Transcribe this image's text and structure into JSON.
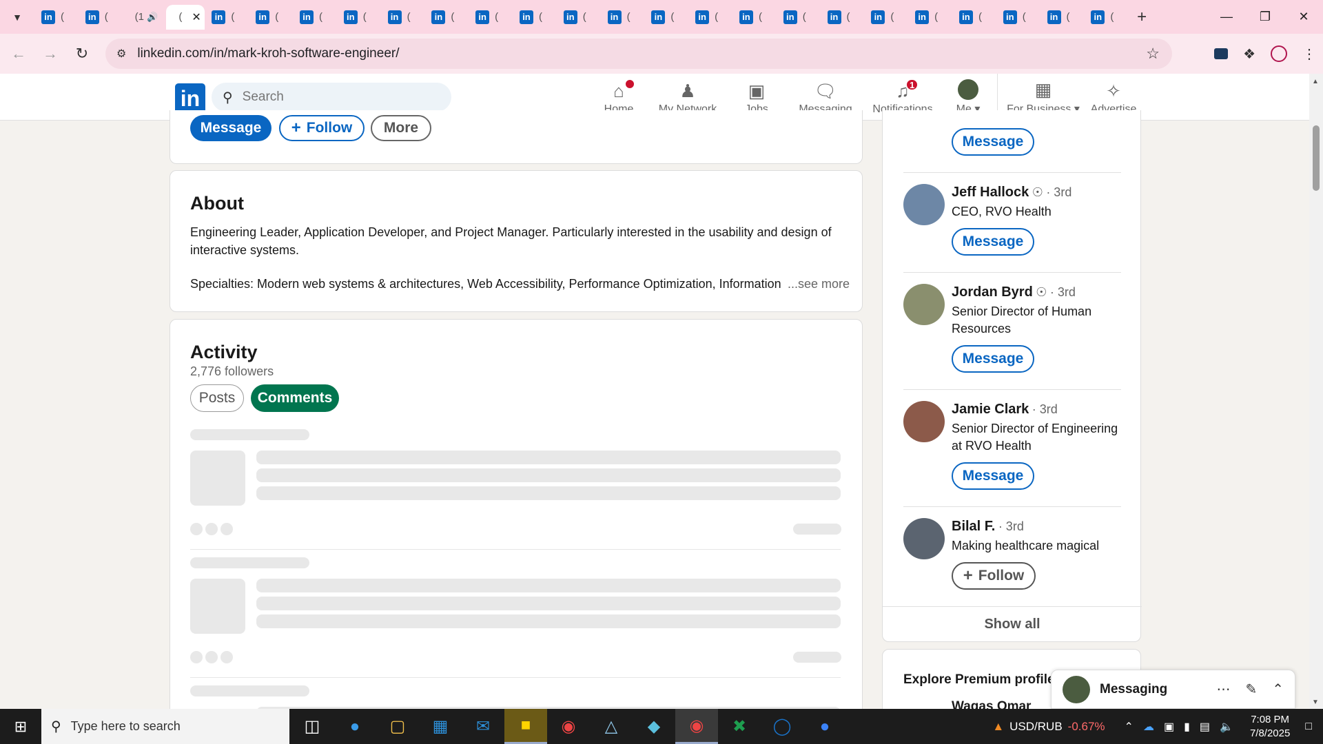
{
  "browser": {
    "tabs": [
      {
        "label": "(",
        "icon": "linkedin-icon"
      },
      {
        "label": "(",
        "icon": "linkedin-icon"
      },
      {
        "label": "(1",
        "icon": "speaker-icon"
      },
      {
        "label": "(",
        "icon": "",
        "active": true
      },
      {
        "label": "(",
        "icon": "linkedin-icon"
      },
      {
        "label": "(",
        "icon": "linkedin-icon"
      },
      {
        "label": "(",
        "icon": "linkedin-icon"
      },
      {
        "label": "(",
        "icon": "linkedin-icon"
      },
      {
        "label": "(",
        "icon": "linkedin-icon"
      },
      {
        "label": "(",
        "icon": "linkedin-icon"
      },
      {
        "label": "(",
        "icon": "linkedin-icon"
      },
      {
        "label": "(",
        "icon": "linkedin-icon"
      },
      {
        "label": "(",
        "icon": "linkedin-icon"
      },
      {
        "label": "(",
        "icon": "linkedin-icon"
      },
      {
        "label": "(",
        "icon": "linkedin-icon"
      },
      {
        "label": "(",
        "icon": "linkedin-icon"
      },
      {
        "label": "(",
        "icon": "linkedin-icon"
      },
      {
        "label": "(",
        "icon": "linkedin-icon"
      },
      {
        "label": "(",
        "icon": "linkedin-icon"
      },
      {
        "label": "(",
        "icon": "linkedin-icon"
      },
      {
        "label": "(",
        "icon": "linkedin-icon"
      },
      {
        "label": "(",
        "icon": "linkedin-icon"
      },
      {
        "label": "(",
        "icon": "linkedin-icon"
      },
      {
        "label": "(",
        "icon": "linkedin-icon"
      },
      {
        "label": "(",
        "icon": "linkedin-icon"
      }
    ],
    "url": "linkedin.com/in/mark-kroh-software-engineer/"
  },
  "linkedin": {
    "logo": "in",
    "search_placeholder": "Search",
    "nav": [
      {
        "label": "Home",
        "icon": "home-icon",
        "badge": ""
      },
      {
        "label": "My Network",
        "icon": "network-icon",
        "badge": ""
      },
      {
        "label": "Jobs",
        "icon": "briefcase-icon",
        "badge": ""
      },
      {
        "label": "Messaging",
        "icon": "chat-icon",
        "badge": ""
      },
      {
        "label": "Notifications",
        "icon": "bell-icon",
        "badge": "1"
      },
      {
        "label": "Me",
        "icon": "avatar-icon",
        "badge": ""
      }
    ],
    "business": {
      "label": "For Business",
      "icon": "grid-icon"
    },
    "advertise": {
      "label": "Advertise",
      "icon": "advertise-icon"
    }
  },
  "profile": {
    "actions": {
      "message": "Message",
      "follow": "Follow",
      "more": "More"
    },
    "about": {
      "title": "About",
      "paragraph1": "Engineering Leader, Application Developer, and Project Manager. Particularly interested in the usability and design of interactive systems.",
      "paragraph2": "Specialties: Modern web systems & architectures, Web Accessibility, Performance Optimization, Information Ar",
      "see_more": "...see more"
    },
    "activity": {
      "title": "Activity",
      "followers": "2,776 followers",
      "tabs": [
        {
          "label": "Posts",
          "active": false
        },
        {
          "label": "Comments",
          "active": true
        }
      ]
    }
  },
  "sidebar": {
    "top_message": "Message",
    "people": [
      {
        "name": "Jeff Hallock",
        "verified": true,
        "degree": "· 3rd",
        "title_lines": [
          "CEO, RVO Health"
        ],
        "action": "Message",
        "avatar_color": "#6d87a6"
      },
      {
        "name": "Jordan Byrd",
        "verified": true,
        "degree": "· 3rd",
        "title_lines": [
          "Senior Director of Human",
          "Resources"
        ],
        "action": "Message",
        "avatar_color": "#8a8f6e"
      },
      {
        "name": "Jamie Clark",
        "verified": false,
        "degree": "· 3rd",
        "title_lines": [
          "Senior Director of Engineering",
          "at RVO Health"
        ],
        "action": "Message",
        "avatar_color": "#8c5a4a"
      },
      {
        "name": "Bilal F.",
        "verified": false,
        "degree": "· 3rd",
        "title_lines": [
          "Making healthcare magical"
        ],
        "action": "Follow",
        "avatar_color": "#5b6470"
      }
    ],
    "show_all": "Show all",
    "premium_title": "Explore Premium profile",
    "premium_person": "Waqas Omar"
  },
  "messaging_dock": {
    "title": "Messaging"
  },
  "taskbar": {
    "search_placeholder": "Type here to search",
    "stock": {
      "pair": "USD/RUB",
      "change": "-0.67%"
    },
    "time": "7:08 PM",
    "date": "7/8/2025"
  }
}
